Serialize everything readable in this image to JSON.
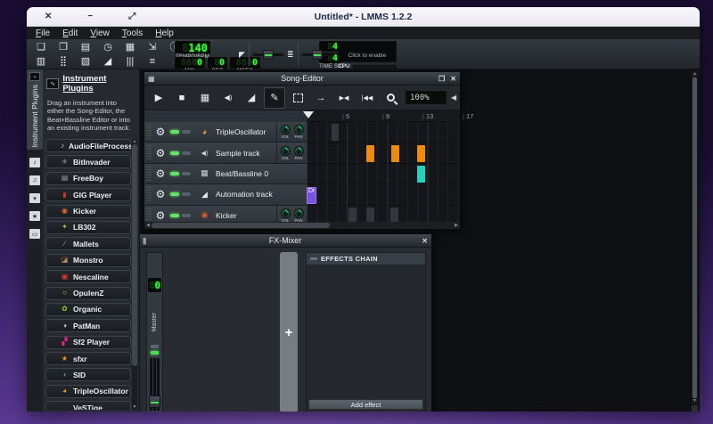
{
  "window": {
    "title": "Untitled* - LMMS 1.2.2",
    "controls": {
      "close": "✕",
      "minimize": "−",
      "resize": "⤢"
    },
    "menus": [
      "File",
      "Edit",
      "View",
      "Tools",
      "Help"
    ],
    "toolbar": {
      "row1": [
        {
          "name": "new-project",
          "glyph": "❏"
        },
        {
          "name": "open-project",
          "glyph": "❐"
        },
        {
          "name": "recent-projects",
          "glyph": "▤"
        },
        {
          "name": "open-recent",
          "glyph": "◷"
        },
        {
          "name": "save-project",
          "glyph": "▦"
        },
        {
          "name": "export-project",
          "glyph": "⇲"
        },
        {
          "name": "project-info",
          "glyph": "ⓘ"
        },
        {
          "name": "metronome",
          "glyph": "◭"
        }
      ],
      "row2": [
        {
          "name": "song-editor-toggle",
          "glyph": "▥"
        },
        {
          "name": "bb-editor-toggle",
          "glyph": "⣿"
        },
        {
          "name": "piano-roll-toggle",
          "glyph": "▨"
        },
        {
          "name": "automation-editor-toggle",
          "glyph": "◢"
        },
        {
          "name": "fx-mixer-toggle",
          "glyph": "|||"
        },
        {
          "name": "project-notes-toggle",
          "glyph": "≡"
        },
        {
          "name": "controller-rack-toggle",
          "glyph": "◔"
        }
      ],
      "tempo": {
        "ghost": "8",
        "value": "140",
        "label": "TEMPO/BPM"
      },
      "time": {
        "min": {
          "ghost": "888",
          "value": "0",
          "label": "MIN"
        },
        "sec": {
          "ghost": "8",
          "value": "0",
          "label": "SEC"
        },
        "msec": {
          "ghost": "888",
          "value": "0",
          "label": "MSEC"
        }
      },
      "timesig": {
        "num_ghost": "8",
        "num": "4",
        "den_ghost": "8",
        "den": "4",
        "label": "TIME SIG"
      },
      "master_volume_icon": "◤",
      "master_pitch_icon": "≣",
      "visualizer_text": "Click to enable",
      "cpu_label": "CPU"
    }
  },
  "sidebar": {
    "active_tab_label": "Instrument Plugins",
    "header": "Instrument Plugins",
    "description": "Drag an instrument into either the Song-Editor, the Beat+Bassline Editor or into an existing instrument track.",
    "tab_icons": [
      {
        "name": "my-projects",
        "glyph": "♪"
      },
      {
        "name": "my-samples",
        "glyph": "♫"
      },
      {
        "name": "my-presets",
        "glyph": "▾"
      },
      {
        "name": "my-home",
        "glyph": "★"
      },
      {
        "name": "my-computer",
        "glyph": "▭"
      }
    ],
    "plugins": [
      {
        "name": "AudioFileProcessor",
        "icon": "♪",
        "color": "#d8dbde"
      },
      {
        "name": "BitInvader",
        "icon": "✳",
        "color": "#9aa0a6"
      },
      {
        "name": "FreeBoy",
        "icon": "▤",
        "color": "#9aa0a6"
      },
      {
        "name": "GIG Player",
        "icon": "▮",
        "color": "#c0392b"
      },
      {
        "name": "Kicker",
        "icon": "◉",
        "color": "#e06a2b"
      },
      {
        "name": "LB302",
        "icon": "✦",
        "color": "#8ec85a"
      },
      {
        "name": "Mallets",
        "icon": "∕",
        "color": "#c8a165"
      },
      {
        "name": "Monstro",
        "icon": "◪",
        "color": "#b08d57"
      },
      {
        "name": "Nescaline",
        "icon": "▣",
        "color": "#d93a2f"
      },
      {
        "name": "OpulenZ",
        "icon": "○",
        "color": "#e8c83a"
      },
      {
        "name": "Organic",
        "icon": "✿",
        "color": "#9acd32"
      },
      {
        "name": "PatMan",
        "icon": "◑",
        "color": "#ecf0f1"
      },
      {
        "name": "Sf2 Player",
        "icon": "▞",
        "color": "#e91e8c"
      },
      {
        "name": "sfxr",
        "icon": "★",
        "color": "#f39c12"
      },
      {
        "name": "SID",
        "icon": "◖",
        "color": "#4a90d9"
      },
      {
        "name": "TripleOscillator",
        "icon": "◕",
        "color": "#f0a030"
      },
      {
        "name": "VeSTige",
        "icon": "∙∙",
        "color": "#d94a3a"
      }
    ]
  },
  "song_editor": {
    "title": "Song-Editor",
    "window_icon": "▦",
    "restore_glyph": "❐",
    "close_glyph": "✕",
    "buttons": {
      "play": "▶",
      "stop": "■",
      "add_bb_track": "▦",
      "add_sample_track": "◀)",
      "add_automation_track": "◢",
      "draw_mode": "✎",
      "autoscroll": "→",
      "loop_points": "▶◀",
      "back_to_start": "|◀◀",
      "zoom_dec": "◀"
    },
    "zoom_level": "100%",
    "timeline_ticks": [
      "5",
      "9",
      "13",
      "17"
    ],
    "vol_label": "VOL",
    "pan_label": "PAN",
    "tracks": [
      {
        "name": "TripleOscillator",
        "icon": "◕",
        "icon_color": "#f0a030"
      },
      {
        "name": "Sample track",
        "icon": "◀)",
        "icon_color": "#cfd4d8"
      },
      {
        "name": "Beat/Bassline 0",
        "icon": "▦",
        "icon_color": "#cfd4d8"
      },
      {
        "name": "Automation track",
        "icon": "◢",
        "icon_color": "#e8ecef"
      },
      {
        "name": "Kicker",
        "icon": "◉",
        "icon_color": "#e05a2b"
      }
    ],
    "clips": {
      "colors": {
        "sample": "#ec8b10",
        "bb": "#25d0bd",
        "automation": "#7b52e0",
        "ghost": "#31373d"
      },
      "automation_label": "Dr"
    }
  },
  "fx_mixer": {
    "title": "FX-Mixer",
    "window_icon": "|||",
    "close_glyph": "✕",
    "master_label": "Master",
    "lcd_ghost": "8",
    "lcd_value": "0",
    "add_channel_glyph": "+",
    "effects_chain_label": "EFFECTS CHAIN",
    "add_effect_label": "Add effect"
  }
}
